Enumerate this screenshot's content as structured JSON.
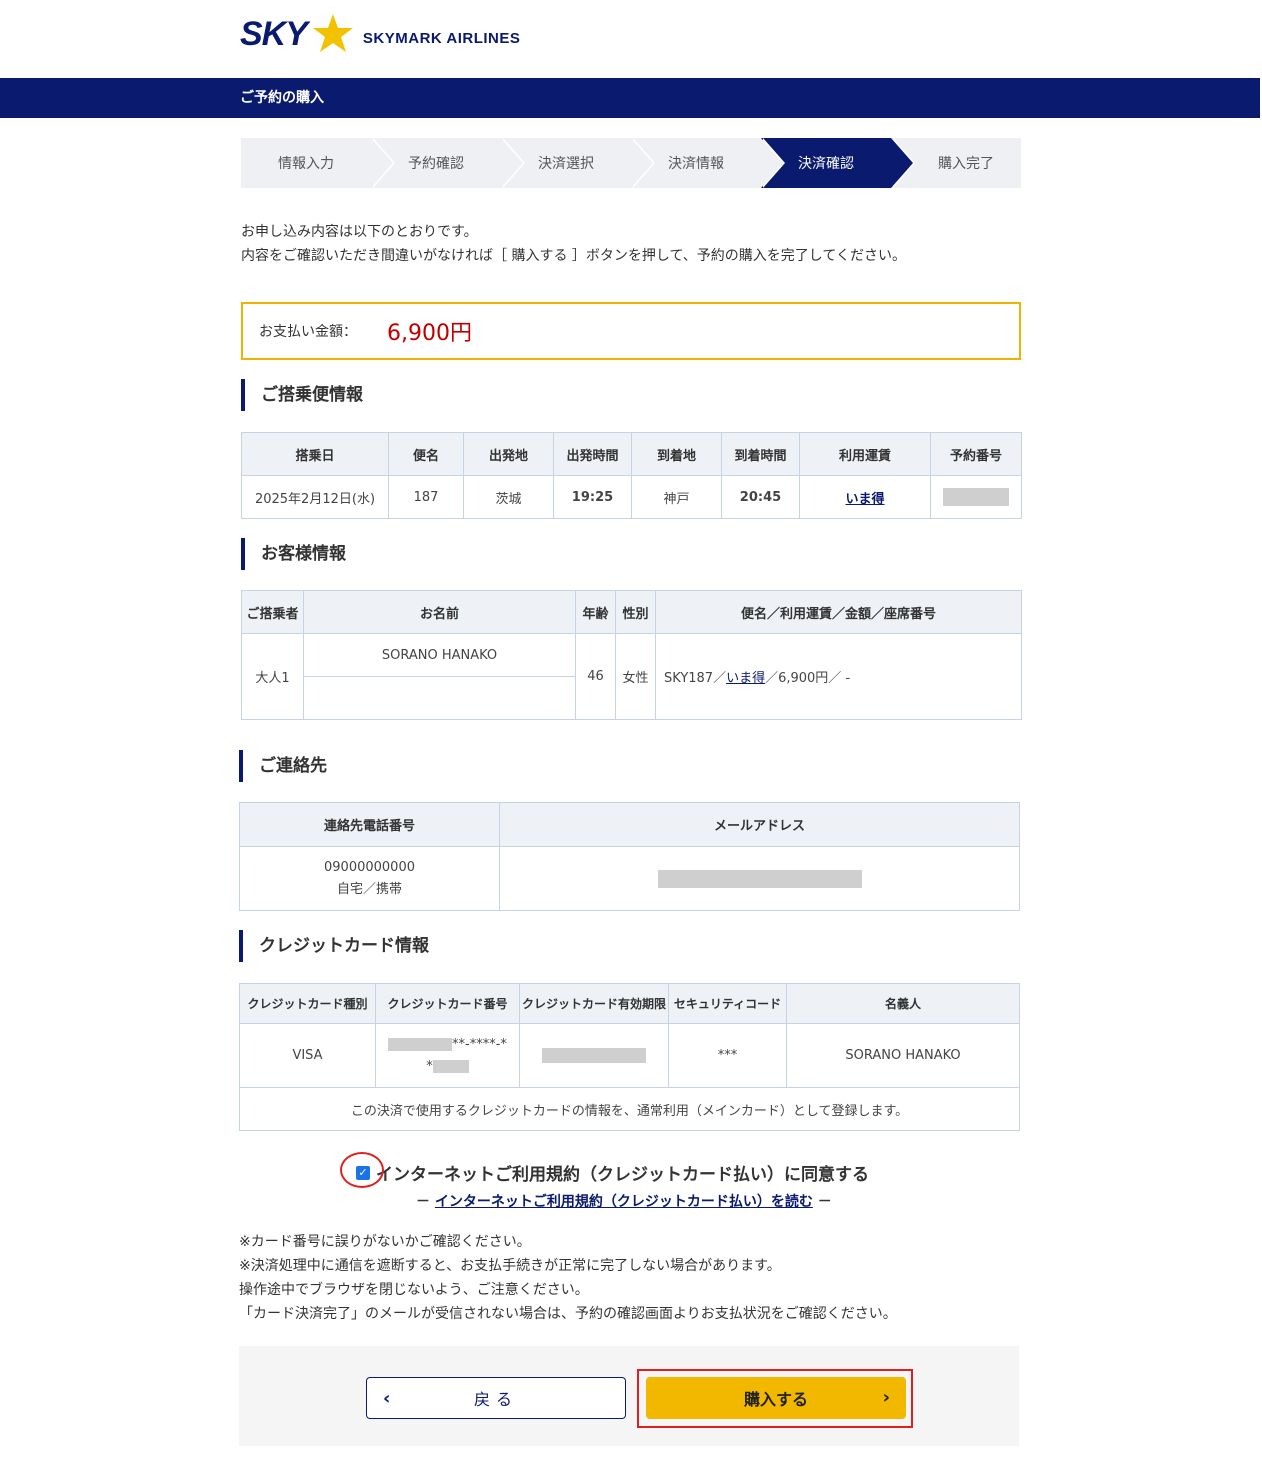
{
  "header": {
    "logo_sky": "SKY",
    "logo_airline": "SKYMARK AIRLINES",
    "title": "ご予約の購入",
    "brand_color": "#0a1a6e",
    "accent_color": "#f2b800"
  },
  "steps": [
    {
      "label": "情報入力",
      "active": false
    },
    {
      "label": "予約確認",
      "active": false
    },
    {
      "label": "決済選択",
      "active": false
    },
    {
      "label": "決済情報",
      "active": false
    },
    {
      "label": "決済確認",
      "active": true
    },
    {
      "label": "購入完了",
      "active": false
    }
  ],
  "intro": {
    "line1": "お申し込み内容は以下のとおりです。",
    "line2": "内容をご確認いただき間違いがなければ［ 購入する ］ボタンを押して、予約の購入を完了してください。"
  },
  "payment": {
    "label": "お支払い金額：",
    "amount": "6,900円"
  },
  "flight": {
    "section_title": "ご搭乗便情報",
    "headers": [
      "搭乗日",
      "便名",
      "出発地",
      "出発時間",
      "到着地",
      "到着時間",
      "利用運賃",
      "予約番号"
    ],
    "row": {
      "date": "2025年2月12日(水)",
      "flight_no": "187",
      "origin": "茨城",
      "dep_time": "19:25",
      "destination": "神戸",
      "arr_time": "20:45",
      "fare": "いま得"
    }
  },
  "passenger": {
    "section_title": "お客様情報",
    "headers": [
      "ご搭乗者",
      "お名前",
      "年齢",
      "性別",
      "便名／利用運賃／金額／座席番号"
    ],
    "row": {
      "type": "大人1",
      "name": "SORANO HANAKO",
      "age": "46",
      "gender": "女性",
      "detail_prefix": "SKY187／",
      "detail_fare": "いま得",
      "detail_suffix": "／6,900円／ -"
    }
  },
  "contact": {
    "section_title": "ご連絡先",
    "headers": [
      "連絡先電話番号",
      "メールアドレス"
    ],
    "phone": "09000000000",
    "phone_type": "自宅／携帯"
  },
  "card": {
    "section_title": "クレジットカード情報",
    "headers": [
      "クレジットカード種別",
      "クレジットカード番号",
      "クレジットカード有効期限",
      "セキュリティコード",
      "名義人"
    ],
    "type": "VISA",
    "number_visible_1": "**-****-*",
    "number_visible_2": "*",
    "security_code": "***",
    "holder": "SORANO HANAKO",
    "note": "この決済で使用するクレジットカードの情報を、通常利用（メインカード）として登録します。"
  },
  "agreement": {
    "checked": true,
    "label": "インターネットご利用規約（クレジットカード払い）に同意する",
    "link_prefix": "－ ",
    "link": "インターネットご利用規約（クレジットカード払い）を読む",
    "link_suffix": " －"
  },
  "notes": [
    "※カード番号に誤りがないかご確認ください。",
    "※決済処理中に通信を遮断すると、お支払手続きが正常に完了しない場合があります。",
    "操作途中でブラウザを閉じないよう、ご注意ください。",
    "「カード決済完了」のメールが受信されない場合は、予約の確認画面よりお支払状況をご確認ください。"
  ],
  "buttons": {
    "back": "戻る",
    "buy": "購入する"
  }
}
